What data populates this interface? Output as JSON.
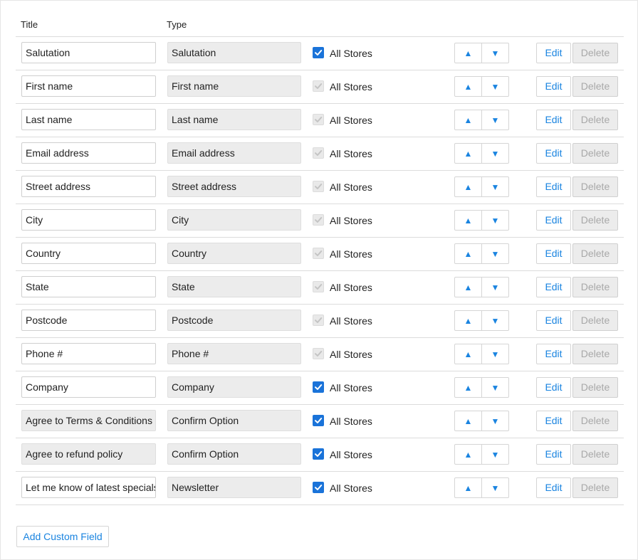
{
  "header": {
    "title_col": "Title",
    "type_col": "Type"
  },
  "store_label": "All Stores",
  "edit_label": "Edit",
  "delete_label": "Delete",
  "up_glyph": "▲",
  "down_glyph": "▼",
  "add_button": "Add Custom Field",
  "colors": {
    "accent": "#1a84e0",
    "checkbox": "#1a73d9",
    "disabled_bg": "#ececec"
  },
  "rows": [
    {
      "title": "Salutation",
      "type": "Salutation",
      "checked": true,
      "title_editable": true
    },
    {
      "title": "First name",
      "type": "First name",
      "checked": false,
      "title_editable": true
    },
    {
      "title": "Last name",
      "type": "Last name",
      "checked": false,
      "title_editable": true
    },
    {
      "title": "Email address",
      "type": "Email address",
      "checked": false,
      "title_editable": true
    },
    {
      "title": "Street address",
      "type": "Street address",
      "checked": false,
      "title_editable": true
    },
    {
      "title": "City",
      "type": "City",
      "checked": false,
      "title_editable": true
    },
    {
      "title": "Country",
      "type": "Country",
      "checked": false,
      "title_editable": true
    },
    {
      "title": "State",
      "type": "State",
      "checked": false,
      "title_editable": true
    },
    {
      "title": "Postcode",
      "type": "Postcode",
      "checked": false,
      "title_editable": true
    },
    {
      "title": "Phone #",
      "type": "Phone #",
      "checked": false,
      "title_editable": true
    },
    {
      "title": "Company",
      "type": "Company",
      "checked": true,
      "title_editable": true
    },
    {
      "title": "Agree to Terms & Conditions",
      "type": "Confirm Option",
      "checked": true,
      "title_editable": false
    },
    {
      "title": "Agree to refund policy",
      "type": "Confirm Option",
      "checked": true,
      "title_editable": false
    },
    {
      "title": "Let me know of latest specials",
      "type": "Newsletter",
      "checked": true,
      "title_editable": true
    }
  ]
}
